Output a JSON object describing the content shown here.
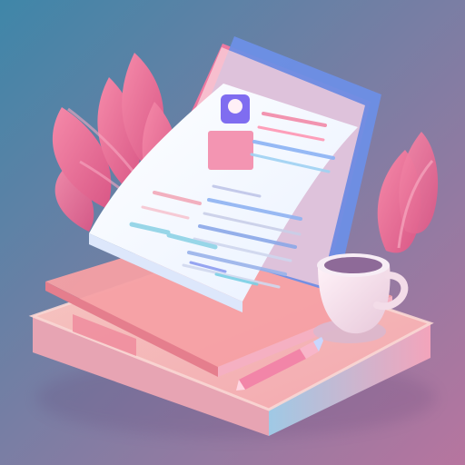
{
  "scene": {
    "palette": {
      "bg_top": "#3f86a8",
      "bg_bottom": "#b7759f",
      "platform_top": "#f7b9b5",
      "platform_side": "#b9dbef",
      "accent_pink": "#f26a98",
      "accent_blue": "#4b7fe0",
      "paper": "#f5f8ff",
      "cup": "#f6e2ec"
    },
    "icons": [
      "leaf-icon",
      "document-icon",
      "clipboard-icon",
      "cup-icon",
      "pen-icon",
      "avatar-icon"
    ]
  }
}
